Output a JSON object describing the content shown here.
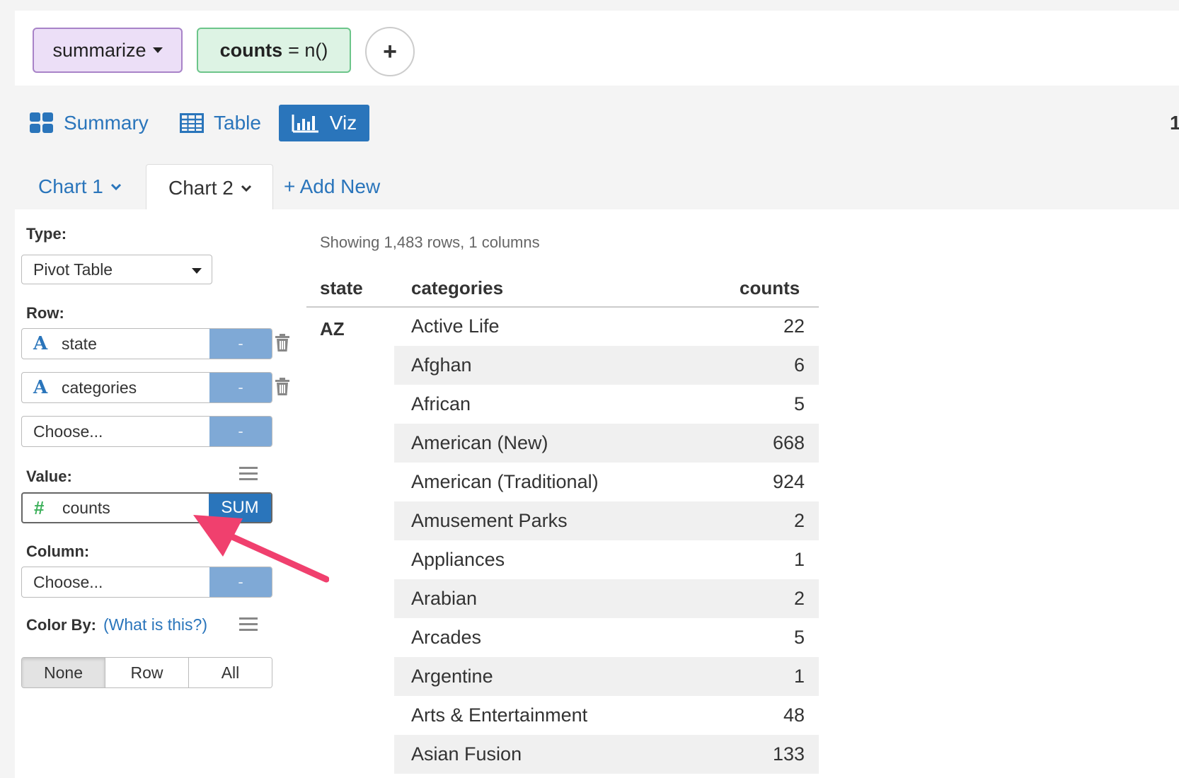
{
  "pipeline": {
    "command": "summarize",
    "expression_bold": "counts",
    "expression_rest": "= n()",
    "add_label": "+"
  },
  "views": {
    "summary": "Summary",
    "table": "Table",
    "viz": "Viz",
    "edge_glyph": "1"
  },
  "chart_tabs": {
    "chart1": "Chart 1",
    "chart2": "Chart 2",
    "add_new": "+ Add New"
  },
  "config": {
    "type_label": "Type:",
    "type_value": "Pivot Table",
    "row_label": "Row:",
    "rows": [
      {
        "icon": "A",
        "name": "state",
        "btn": "-"
      },
      {
        "icon": "A",
        "name": "categories",
        "btn": "-"
      },
      {
        "icon": "",
        "name": "Choose...",
        "btn": "-"
      }
    ],
    "value_label": "Value:",
    "value": {
      "icon": "#",
      "name": "counts",
      "agg": "SUM"
    },
    "column_label": "Column:",
    "column": {
      "name": "Choose...",
      "btn": "-"
    },
    "colorby_label": "Color By:",
    "colorby_help": "(What is this?)",
    "colorby_options": [
      "None",
      "Row",
      "All"
    ]
  },
  "table": {
    "showing": "Showing 1,483 rows, 1 columns",
    "headers": [
      "state",
      "categories",
      "counts"
    ],
    "state": "AZ",
    "rows": [
      {
        "category": "Active Life",
        "count": "22"
      },
      {
        "category": "Afghan",
        "count": "6"
      },
      {
        "category": "African",
        "count": "5"
      },
      {
        "category": "American (New)",
        "count": "668"
      },
      {
        "category": "American (Traditional)",
        "count": "924"
      },
      {
        "category": "Amusement Parks",
        "count": "2"
      },
      {
        "category": "Appliances",
        "count": "1"
      },
      {
        "category": "Arabian",
        "count": "2"
      },
      {
        "category": "Arcades",
        "count": "5"
      },
      {
        "category": "Argentine",
        "count": "1"
      },
      {
        "category": "Arts & Entertainment",
        "count": "48"
      },
      {
        "category": "Asian Fusion",
        "count": "133"
      }
    ]
  },
  "colors": {
    "accent": "#2a75bb",
    "arrow": "#f0406e"
  }
}
